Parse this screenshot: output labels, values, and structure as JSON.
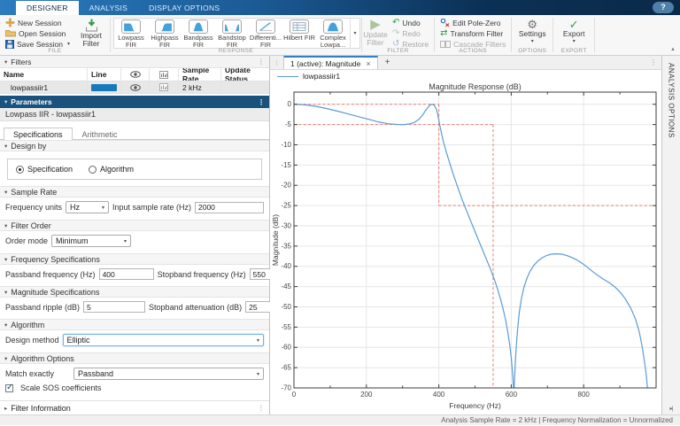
{
  "icons": {
    "dropdown": "▾",
    "collapse_down": "▾",
    "collapse_right": "▸",
    "menu": "⋮",
    "close": "×",
    "add_tab": "+",
    "help": "?",
    "undo": "↶",
    "redo": "↷",
    "restore": "↺",
    "gear": "⚙",
    "check": "✓",
    "transform": "⇄",
    "play": "▶",
    "collapse_ribbon": "▲",
    "dock": "▸|",
    "grip": "⋮"
  },
  "ribbon": {
    "tabs": [
      {
        "label": "DESIGNER",
        "selected": true
      },
      {
        "label": "ANALYSIS",
        "selected": false
      },
      {
        "label": "DISPLAY OPTIONS",
        "selected": false
      }
    ],
    "file": {
      "label": "FILE",
      "new": "New Session",
      "open": "Open Session",
      "save": "Save Session",
      "import_line1": "Import",
      "import_line2": "Filter"
    },
    "response": {
      "label": "RESPONSE",
      "items": [
        {
          "line1": "Lowpass",
          "line2": "FIR"
        },
        {
          "line1": "Highpass",
          "line2": "FIR"
        },
        {
          "line1": "Bandpass",
          "line2": "FIR"
        },
        {
          "line1": "Bandstop",
          "line2": "FIR"
        },
        {
          "line1": "Differenti...",
          "line2": "FIR"
        },
        {
          "line1": "Hilbert FIR",
          "line2": ""
        },
        {
          "line1": "Complex",
          "line2": "Lowpa..."
        }
      ]
    },
    "filter": {
      "label": "FILTER",
      "update_line1": "Update",
      "update_line2": "Filter",
      "undo": "Undo",
      "redo": "Redo",
      "restore": "Restore"
    },
    "actions": {
      "label": "ACTIONS",
      "edit_pole_zero": "Edit Pole-Zero",
      "transform": "Transform Filter",
      "cascade": "Cascade Filters"
    },
    "options": {
      "label": "OPTIONS",
      "settings": "Settings"
    },
    "export": {
      "label": "EXPORT",
      "export": "Export"
    }
  },
  "filters_panel": {
    "title": "Filters",
    "columns": {
      "name": "Name",
      "line": "Line",
      "sample_rate": "Sample Rate",
      "update_status": "Update Status"
    },
    "row": {
      "name": "lowpassiir1",
      "line_color": "#1878be",
      "sample_rate": "2 kHz",
      "update_status": ""
    }
  },
  "parameters_panel": {
    "title": "Parameters",
    "subtitle": "Lowpass IIR - lowpassiir1",
    "tabs": [
      {
        "label": "Specifications",
        "selected": true
      },
      {
        "label": "Arithmetic",
        "selected": false
      }
    ],
    "design_by": {
      "title": "Design by",
      "options": [
        {
          "label": "Specification",
          "selected": true
        },
        {
          "label": "Algorithm",
          "selected": false
        }
      ]
    },
    "sample_rate": {
      "title": "Sample Rate",
      "frequency_units_label": "Frequency units",
      "frequency_units_value": "Hz",
      "input_rate_label": "Input sample rate (Hz)",
      "input_rate_value": "2000"
    },
    "filter_order": {
      "title": "Filter Order",
      "order_mode_label": "Order mode",
      "order_mode_value": "Minimum"
    },
    "frequency_specs": {
      "title": "Frequency Specifications",
      "passband_label": "Passband frequency (Hz)",
      "passband_value": "400",
      "stopband_label": "Stopband frequency (Hz)",
      "stopband_value": "550"
    },
    "magnitude_specs": {
      "title": "Magnitude Specifications",
      "ripple_label": "Passband ripple (dB)",
      "ripple_value": "5",
      "atten_label": "Stopband attenuation (dB)",
      "atten_value": "25"
    },
    "algorithm": {
      "title": "Algorithm",
      "design_method_label": "Design method",
      "design_method_value": "Elliptic"
    },
    "algorithm_options": {
      "title": "Algorithm Options",
      "match_label": "Match exactly",
      "match_value": "Passband",
      "checkbox_label": "Scale SOS coefficients",
      "checkbox_checked": true
    },
    "filter_information": {
      "title": "Filter Information"
    }
  },
  "plot_panel": {
    "tab_label": "1 (active): Magnitude",
    "legend_label": "lowpassiir1",
    "analysis_options_label": "ANALYSIS OPTIONS"
  },
  "status_bar": {
    "text": "Analysis Sample Rate = 2 kHz | Frequency Normalization = Unnormalized"
  },
  "chart_data": {
    "type": "line",
    "title": "Magnitude Response (dB)",
    "xlabel": "Frequency (Hz)",
    "ylabel": "Magnitude (dB)",
    "xlim": [
      0,
      1000
    ],
    "ylim": [
      -70,
      3
    ],
    "xticks": [
      0,
      200,
      400,
      600,
      800
    ],
    "xminor": [
      100,
      300,
      500,
      700,
      900
    ],
    "yticks": [
      0,
      -5,
      -10,
      -15,
      -20,
      -25,
      -30,
      -35,
      -40,
      -45,
      -50,
      -55,
      -60,
      -65,
      -70
    ],
    "grid": true,
    "grid_color": "#e6e6e6",
    "axis_color": "#3c3c3c",
    "legend_position": "top-left-outside",
    "specs": {
      "passband_hz": 400,
      "stopband_hz": 550,
      "passband_ripple_db": 5,
      "stopband_attenuation_db": 25
    },
    "mask": {
      "color": "#ef8677",
      "segments": [
        [
          [
            0,
            0
          ],
          [
            400,
            0
          ]
        ],
        [
          [
            400,
            0
          ],
          [
            400,
            -25
          ]
        ],
        [
          [
            0,
            -5
          ],
          [
            550,
            -5
          ]
        ],
        [
          [
            550,
            -5
          ],
          [
            550,
            -70
          ]
        ],
        [
          [
            400,
            -25
          ],
          [
            1000,
            -25
          ]
        ]
      ]
    },
    "series": [
      {
        "name": "lowpassiir1",
        "color": "#5b9bd5",
        "points": [
          [
            0,
            0
          ],
          [
            30,
            -0.15
          ],
          [
            60,
            -0.5
          ],
          [
            90,
            -1.05
          ],
          [
            120,
            -1.7
          ],
          [
            150,
            -2.4
          ],
          [
            180,
            -3.1
          ],
          [
            210,
            -3.8
          ],
          [
            235,
            -4.4
          ],
          [
            260,
            -4.8
          ],
          [
            285,
            -4.97
          ],
          [
            305,
            -5
          ],
          [
            320,
            -4.85
          ],
          [
            333,
            -4.45
          ],
          [
            345,
            -3.7
          ],
          [
            355,
            -2.7
          ],
          [
            363,
            -1.6
          ],
          [
            370,
            -0.75
          ],
          [
            376,
            -0.2
          ],
          [
            381,
            0
          ],
          [
            386,
            -0.15
          ],
          [
            390,
            -0.6
          ],
          [
            394,
            -1.4
          ],
          [
            397,
            -2.5
          ],
          [
            400,
            -3.9
          ],
          [
            403,
            -5.3
          ],
          [
            407,
            -7
          ],
          [
            412,
            -9
          ],
          [
            420,
            -11.6
          ],
          [
            430,
            -14.5
          ],
          [
            441,
            -17.6
          ],
          [
            453,
            -20.7
          ],
          [
            466,
            -23.9
          ],
          [
            480,
            -27
          ],
          [
            494,
            -30.1
          ],
          [
            508,
            -33.2
          ],
          [
            521,
            -36
          ],
          [
            533,
            -38.6
          ],
          [
            544,
            -41
          ],
          [
            554,
            -43.4
          ],
          [
            563,
            -45.8
          ],
          [
            571,
            -48.2
          ],
          [
            578,
            -50.7
          ],
          [
            585,
            -53.5
          ],
          [
            591,
            -56.5
          ],
          [
            596,
            -59.5
          ],
          [
            600,
            -62.5
          ],
          [
            603,
            -65.5
          ],
          [
            605,
            -68
          ],
          [
            606,
            -70
          ],
          [
            608,
            -70
          ],
          [
            610,
            -66
          ],
          [
            613,
            -61
          ],
          [
            617,
            -56
          ],
          [
            622,
            -51.5
          ],
          [
            628,
            -48
          ],
          [
            635,
            -45.2
          ],
          [
            643,
            -43
          ],
          [
            652,
            -41.2
          ],
          [
            662,
            -39.8
          ],
          [
            673,
            -38.7
          ],
          [
            685,
            -37.9
          ],
          [
            698,
            -37.3
          ],
          [
            711,
            -37
          ],
          [
            725,
            -36.9
          ],
          [
            739,
            -37
          ],
          [
            753,
            -37.3
          ],
          [
            767,
            -37.8
          ],
          [
            781,
            -38.4
          ],
          [
            795,
            -39.2
          ],
          [
            810,
            -40.2
          ],
          [
            825,
            -41.3
          ],
          [
            840,
            -42.3
          ],
          [
            855,
            -43.2
          ],
          [
            870,
            -44
          ],
          [
            885,
            -45
          ],
          [
            900,
            -46.3
          ],
          [
            915,
            -48
          ],
          [
            930,
            -50.3
          ],
          [
            943,
            -53
          ],
          [
            953,
            -56
          ],
          [
            961,
            -59.5
          ],
          [
            968,
            -63.5
          ],
          [
            973,
            -67
          ],
          [
            976,
            -70
          ]
        ]
      }
    ]
  }
}
